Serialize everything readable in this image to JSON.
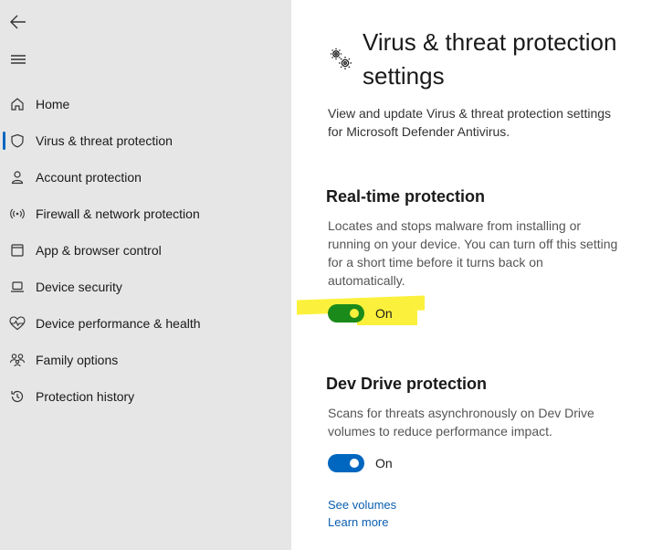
{
  "sidebar": {
    "items": [
      {
        "label": "Home",
        "icon": "home-icon"
      },
      {
        "label": "Virus & threat protection",
        "icon": "shield-icon"
      },
      {
        "label": "Account protection",
        "icon": "person-icon"
      },
      {
        "label": "Firewall & network protection",
        "icon": "wifi-antenna-icon"
      },
      {
        "label": "App & browser control",
        "icon": "app-window-icon"
      },
      {
        "label": "Device security",
        "icon": "laptop-icon"
      },
      {
        "label": "Device performance & health",
        "icon": "heart-pulse-icon"
      },
      {
        "label": "Family options",
        "icon": "family-icon"
      },
      {
        "label": "Protection history",
        "icon": "history-icon"
      }
    ]
  },
  "page": {
    "title": "Virus & threat protection settings",
    "description": "View and update Virus & threat protection settings for Microsoft Defender Antivirus."
  },
  "realtime": {
    "title": "Real-time protection",
    "description": "Locates and stops malware from installing or running on your device. You can turn off this setting for a short time before it turns back on automatically.",
    "state": "On",
    "toggle_color": "#1a8a1a",
    "highlight_color": "#fbf13c"
  },
  "devdrive": {
    "title": "Dev Drive protection",
    "description": "Scans for threats asynchronously on Dev Drive volumes to reduce performance impact.",
    "state": "On",
    "toggle_color": "#0067c0"
  },
  "links": {
    "see_volumes": "See volumes",
    "learn_more": "Learn more"
  }
}
